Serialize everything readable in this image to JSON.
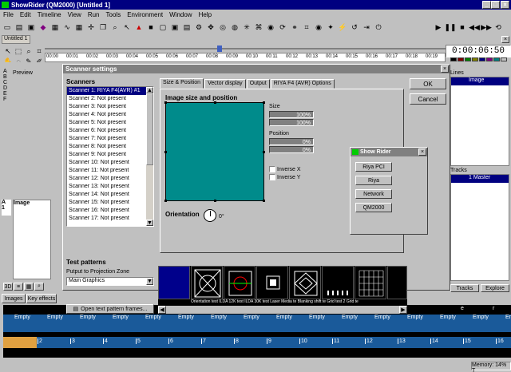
{
  "app": {
    "title": "ShowRider (QM2000) [Untitled 1]",
    "menu": [
      "File",
      "Edit",
      "Timeline",
      "View",
      "Run",
      "Tools",
      "Environment",
      "Window",
      "Help"
    ],
    "doc_tab": "Untitled 1",
    "timecode": "0:00:06:50",
    "ruler_ticks": [
      "00:00",
      "00:01",
      "00:02",
      "00:03",
      "00:04",
      "00:05",
      "00:06",
      "00:07",
      "00:08",
      "00:09",
      "00:10",
      "00:11",
      "00:12",
      "00:13",
      "00:14",
      "00:15",
      "00:16",
      "00:17",
      "00:18",
      "00:19"
    ]
  },
  "left": {
    "preview_label": "Preview",
    "letters": [
      "A",
      "B",
      "C",
      "D",
      "E",
      "F"
    ],
    "image_label": "Image",
    "row_letters": [
      "A",
      "1"
    ]
  },
  "right": {
    "lines_label": "Lines",
    "lines_item": "Image",
    "tracks_label": "Tracks",
    "tracks_item": "1 Master",
    "tab_tracks": "Tracks",
    "tab_explore": "Explore"
  },
  "bottom": {
    "tabs": [
      "Images",
      "Key effects"
    ],
    "column_numbers": [
      "1",
      "2",
      "3",
      "4",
      "5",
      "6",
      "7",
      "8",
      "9",
      "10",
      "11",
      "12",
      "13",
      "14",
      "15",
      "16"
    ],
    "empty_label": "Empty",
    "letter_e": "e",
    "letter_r": "r",
    "status_memory": "Memory: 14% T"
  },
  "dialog": {
    "title": "Scanner settings",
    "scanners_label": "Scanners",
    "scanners": [
      "Scanner 1: RIYA F4(AVR) #1",
      "Scanner 2: Not present",
      "Scanner 3: Not present",
      "Scanner 4: Not present",
      "Scanner 5: Not present",
      "Scanner 6: Not present",
      "Scanner 7: Not present",
      "Scanner 8: Not present",
      "Scanner 9: Not present",
      "Scanner 10: Not present",
      "Scanner 11: Not present",
      "Scanner 12: Not present",
      "Scanner 13: Not present",
      "Scanner 14: Not present",
      "Scanner 15: Not present",
      "Scanner 16: Not present",
      "Scanner 17: Not present"
    ],
    "tabs": [
      "Size & Position",
      "Vector display",
      "Output",
      "RIYA F4 (AVR) Options"
    ],
    "image_size_label": "Image size and position",
    "size_label": "Size",
    "size_values": [
      "100%",
      "100%"
    ],
    "position_label": "Position",
    "position_values": [
      "0%",
      "0%"
    ],
    "inverse_x": "Inverse X",
    "inverse_y": "Inverse Y",
    "orientation_label": "Orientation",
    "orientation_value": "0°",
    "ok": "OK",
    "cancel": "Cancel",
    "test_patterns_label": "Test patterns",
    "output_label": "Putput to Projection Zone",
    "output_select": "Main Graphics",
    "open_btn": "Open text pattern frames...",
    "pattern_caption": "Orientation test ILDA 12K test ILDA 30K test Laser Media te Blanking shift te Grid test 2      Grid te"
  },
  "popup": {
    "title": "Show Rider",
    "buttons": [
      "Riya PCI",
      "Riya",
      "Network",
      "QM2000"
    ]
  },
  "colors": {
    "titlebar": "#000080",
    "teal": "#008b8b",
    "blue_strip": "#1a5a9a"
  }
}
